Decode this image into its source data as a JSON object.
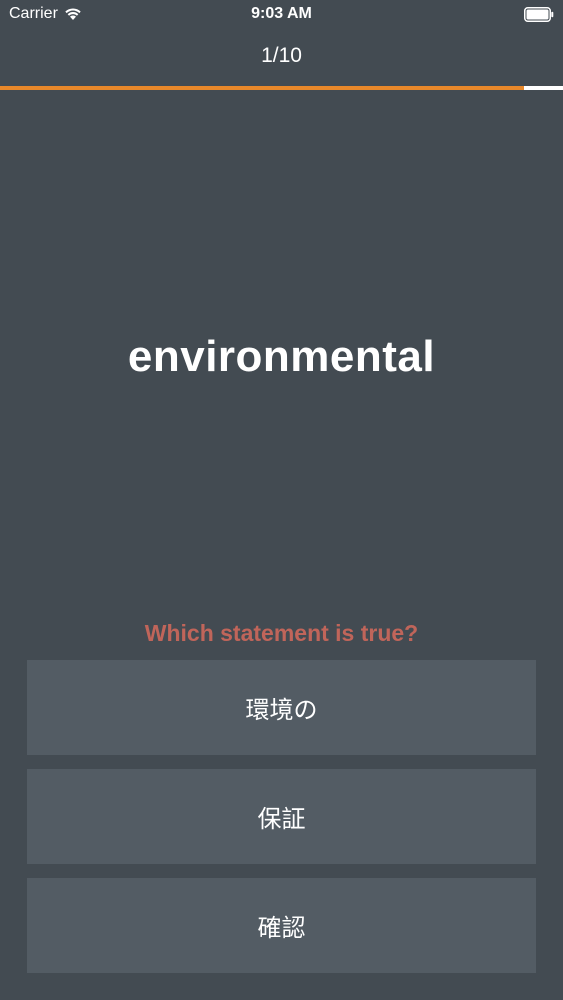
{
  "status_bar": {
    "carrier": "Carrier",
    "time": "9:03 AM"
  },
  "header": {
    "progress_label": "1/10",
    "progress_fraction": 0.93,
    "progress_color": "#e8882a"
  },
  "card": {
    "word": "environmental",
    "question": "Which statement is true?",
    "question_color": "#c0655a"
  },
  "answers": [
    {
      "label": "環境の"
    },
    {
      "label": "保証"
    },
    {
      "label": "確認"
    }
  ],
  "colors": {
    "background": "#434b52",
    "answer_background": "#535c64"
  }
}
